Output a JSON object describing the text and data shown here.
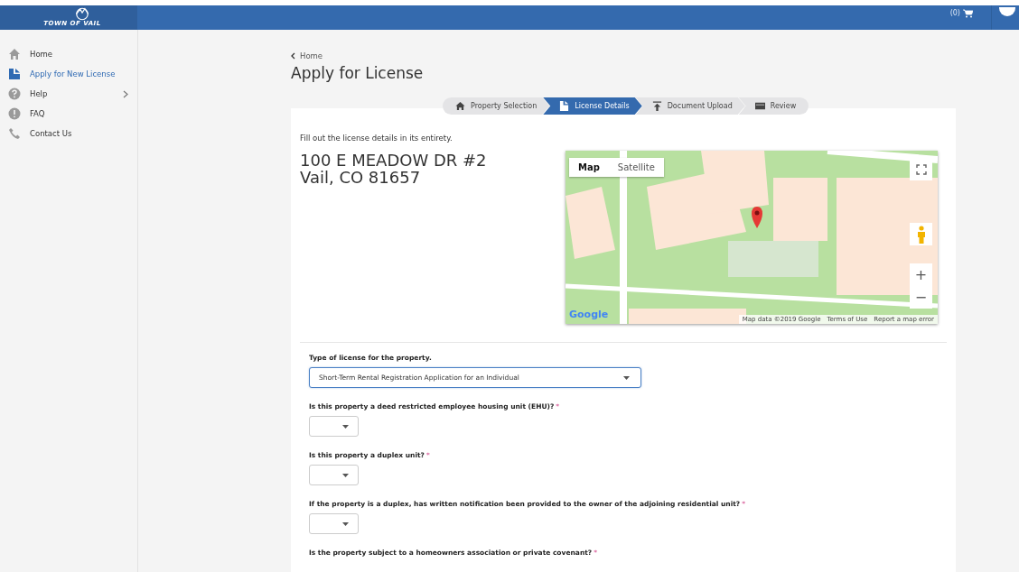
{
  "header": {
    "logo_text": "TOWN OF VAIL",
    "cart": "(0)"
  },
  "sidebar": {
    "items": [
      {
        "label": "Home",
        "kind": "home",
        "selected": false,
        "submenu": false
      },
      {
        "label": "Apply for New License",
        "kind": "document",
        "selected": true,
        "submenu": false
      },
      {
        "label": "Help",
        "kind": "question",
        "selected": false,
        "submenu": true
      },
      {
        "label": "FAQ",
        "kind": "alert",
        "selected": false,
        "submenu": false
      },
      {
        "label": "Contact Us",
        "kind": "phone",
        "selected": false,
        "submenu": false
      }
    ]
  },
  "breadcrumb": "Home",
  "title": "Apply for License",
  "steps": [
    {
      "label": "Property Selection",
      "kind": "home",
      "selected": false
    },
    {
      "label": "License Details",
      "kind": "document",
      "selected": true
    },
    {
      "label": "Document Upload",
      "kind": "upload",
      "selected": false
    },
    {
      "label": "Review",
      "kind": "card",
      "selected": false
    }
  ],
  "intro": "Fill out the license details in its entirety.",
  "address": [
    "100 E MEADOW DR #2",
    "Vail, CO 81657"
  ],
  "map": {
    "types": [
      {
        "label": "Map",
        "selected": true
      },
      {
        "label": "Satellite",
        "selected": false
      }
    ],
    "zoom_in": "+",
    "zoom_out": "−",
    "logo": "Google",
    "attribution": [
      "Map data ©2019 Google",
      "Terms of Use",
      "Report a map error"
    ]
  },
  "form": {
    "license_type": {
      "label": "Type of license for the property.",
      "value": "Short-Term Rental Registration Application for an Individual"
    },
    "questions": [
      {
        "label": "Is this property a deed restricted employee housing unit (EHU)?",
        "required_mark": "*",
        "dropdown": true
      },
      {
        "label": "Is this property a duplex unit?",
        "required_mark": "*",
        "dropdown": true
      },
      {
        "label": "If the property is a duplex, has written notification been provided to the owner of the adjoining residential unit?",
        "required_mark": "*",
        "dropdown": true
      },
      {
        "label": "Is the property subject to a homeowners association or private covenant?",
        "required_mark": "*",
        "dropdown": false
      }
    ]
  }
}
